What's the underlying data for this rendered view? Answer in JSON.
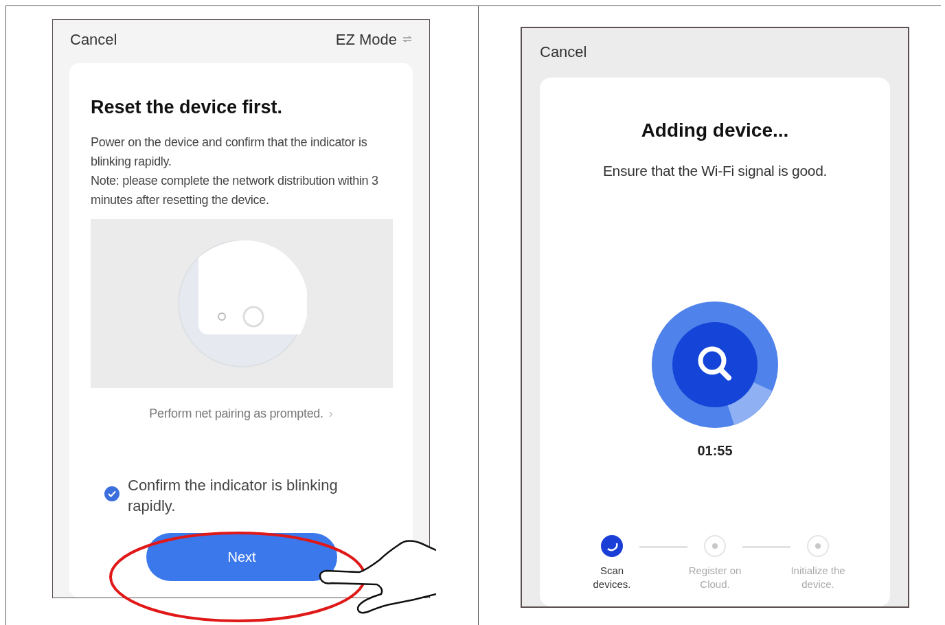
{
  "left_screen": {
    "cancel": "Cancel",
    "mode": "EZ Mode",
    "title": "Reset the device first.",
    "description": [
      "Power on the device and confirm that the indicator is blinking rapidly.",
      "Note: please complete the network distribution within 3 minutes after resetting the device."
    ],
    "help_link": "Perform net pairing as prompted.",
    "help_chevron": "›",
    "confirm": {
      "label": "Confirm the indicator is blinking rapidly.",
      "checked": true
    },
    "next_button": "Next"
  },
  "right_screen": {
    "cancel": "Cancel",
    "title": "Adding device...",
    "subtitle": "Ensure that the Wi-Fi signal is good.",
    "timer": "01:55",
    "steps": [
      {
        "label": "Scan devices.",
        "selected": true
      },
      {
        "label": "Register on Cloud.",
        "selected": false
      },
      {
        "label": "Initialize the device.",
        "selected": false
      }
    ]
  }
}
